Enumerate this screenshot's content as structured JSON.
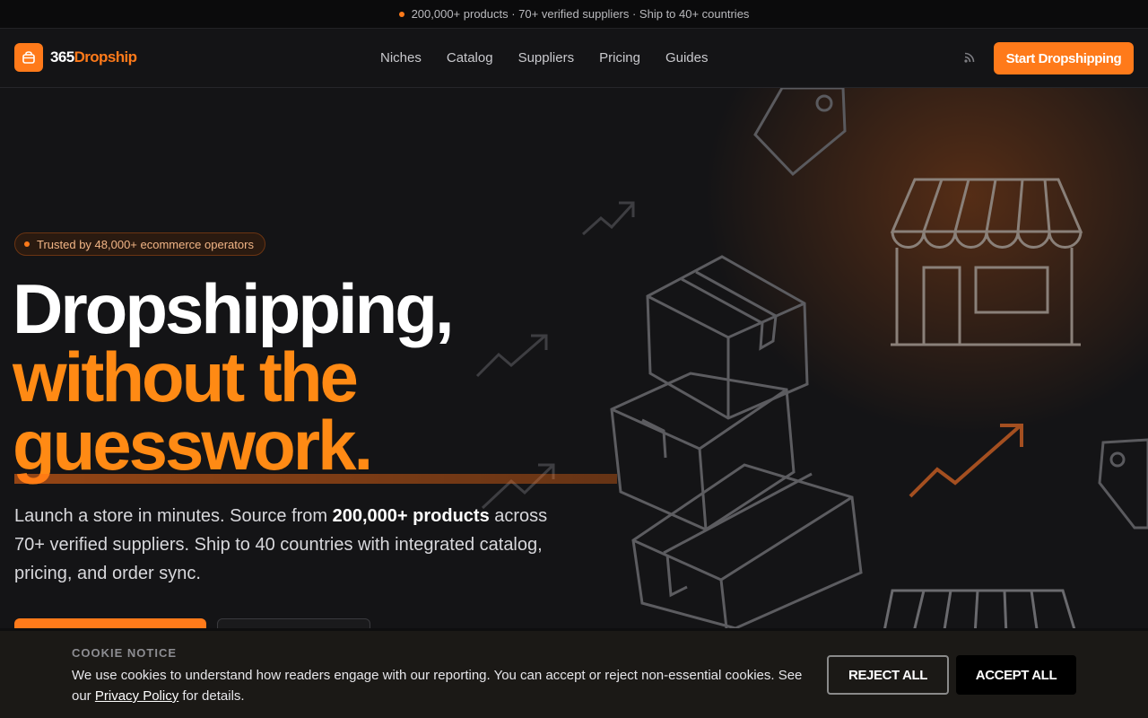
{
  "topbar": {
    "text": "200,000+ products · 70+ verified suppliers · Ship to 40+ countries"
  },
  "brand": {
    "prefix": "365",
    "suffix": "Dropship",
    "accent": "#ff7a1a"
  },
  "nav": {
    "items": [
      {
        "label": "Niches"
      },
      {
        "label": "Catalog"
      },
      {
        "label": "Suppliers"
      },
      {
        "label": "Pricing"
      },
      {
        "label": "Guides"
      }
    ],
    "rss_icon": "rss-icon",
    "cta_label": "Start Dropshipping"
  },
  "hero": {
    "badge": "Trusted by 48,000+ ecommerce operators",
    "headline_line1": "Dropshipping,",
    "headline_line2": "without the",
    "headline_line3": "guesswork.",
    "lead_part1": "Launch a store in minutes. Source from ",
    "lead_bold": "200,000+ products",
    "lead_part2": " across 70+ verified suppliers. Ship to 40 countries with integrated catalog, pricing, and order sync."
  },
  "cookie": {
    "title": "COOKIE NOTICE",
    "text_part1": "We use cookies to understand how readers engage with our reporting. You can accept or reject non-essential cookies. See our ",
    "link": "Privacy Policy",
    "text_part2": " for details.",
    "reject_label": "REJECT ALL",
    "accept_label": "ACCEPT ALL"
  }
}
